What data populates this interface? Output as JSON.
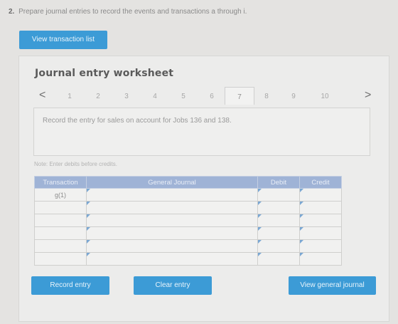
{
  "question": {
    "number": "2.",
    "text": "Prepare journal entries to record the events and transactions a through i."
  },
  "view_transaction_list": "View transaction list",
  "worksheet": {
    "title": "Journal entry worksheet",
    "prev_arrow": "<",
    "next_arrow": ">",
    "pages": [
      "1",
      "2",
      "3",
      "4",
      "5",
      "6",
      "7",
      "8",
      "9",
      "10"
    ],
    "active_page": "7",
    "instruction": "Record the entry for sales on account for Jobs 136 and 138.",
    "note": "Note: Enter debits before credits."
  },
  "table": {
    "headers": {
      "transaction": "Transaction",
      "general_journal": "General Journal",
      "debit": "Debit",
      "credit": "Credit"
    },
    "rows": [
      {
        "transaction": "g(1)",
        "account": "",
        "debit": "",
        "credit": ""
      },
      {
        "transaction": "",
        "account": "",
        "debit": "",
        "credit": ""
      },
      {
        "transaction": "",
        "account": "",
        "debit": "",
        "credit": ""
      },
      {
        "transaction": "",
        "account": "",
        "debit": "",
        "credit": ""
      },
      {
        "transaction": "",
        "account": "",
        "debit": "",
        "credit": ""
      },
      {
        "transaction": "",
        "account": "",
        "debit": "",
        "credit": ""
      }
    ]
  },
  "buttons": {
    "record": "Record entry",
    "clear": "Clear entry",
    "view_general": "View general journal"
  },
  "colors": {
    "accent": "#3c9bd6",
    "table_header": "#9fb3d6"
  }
}
